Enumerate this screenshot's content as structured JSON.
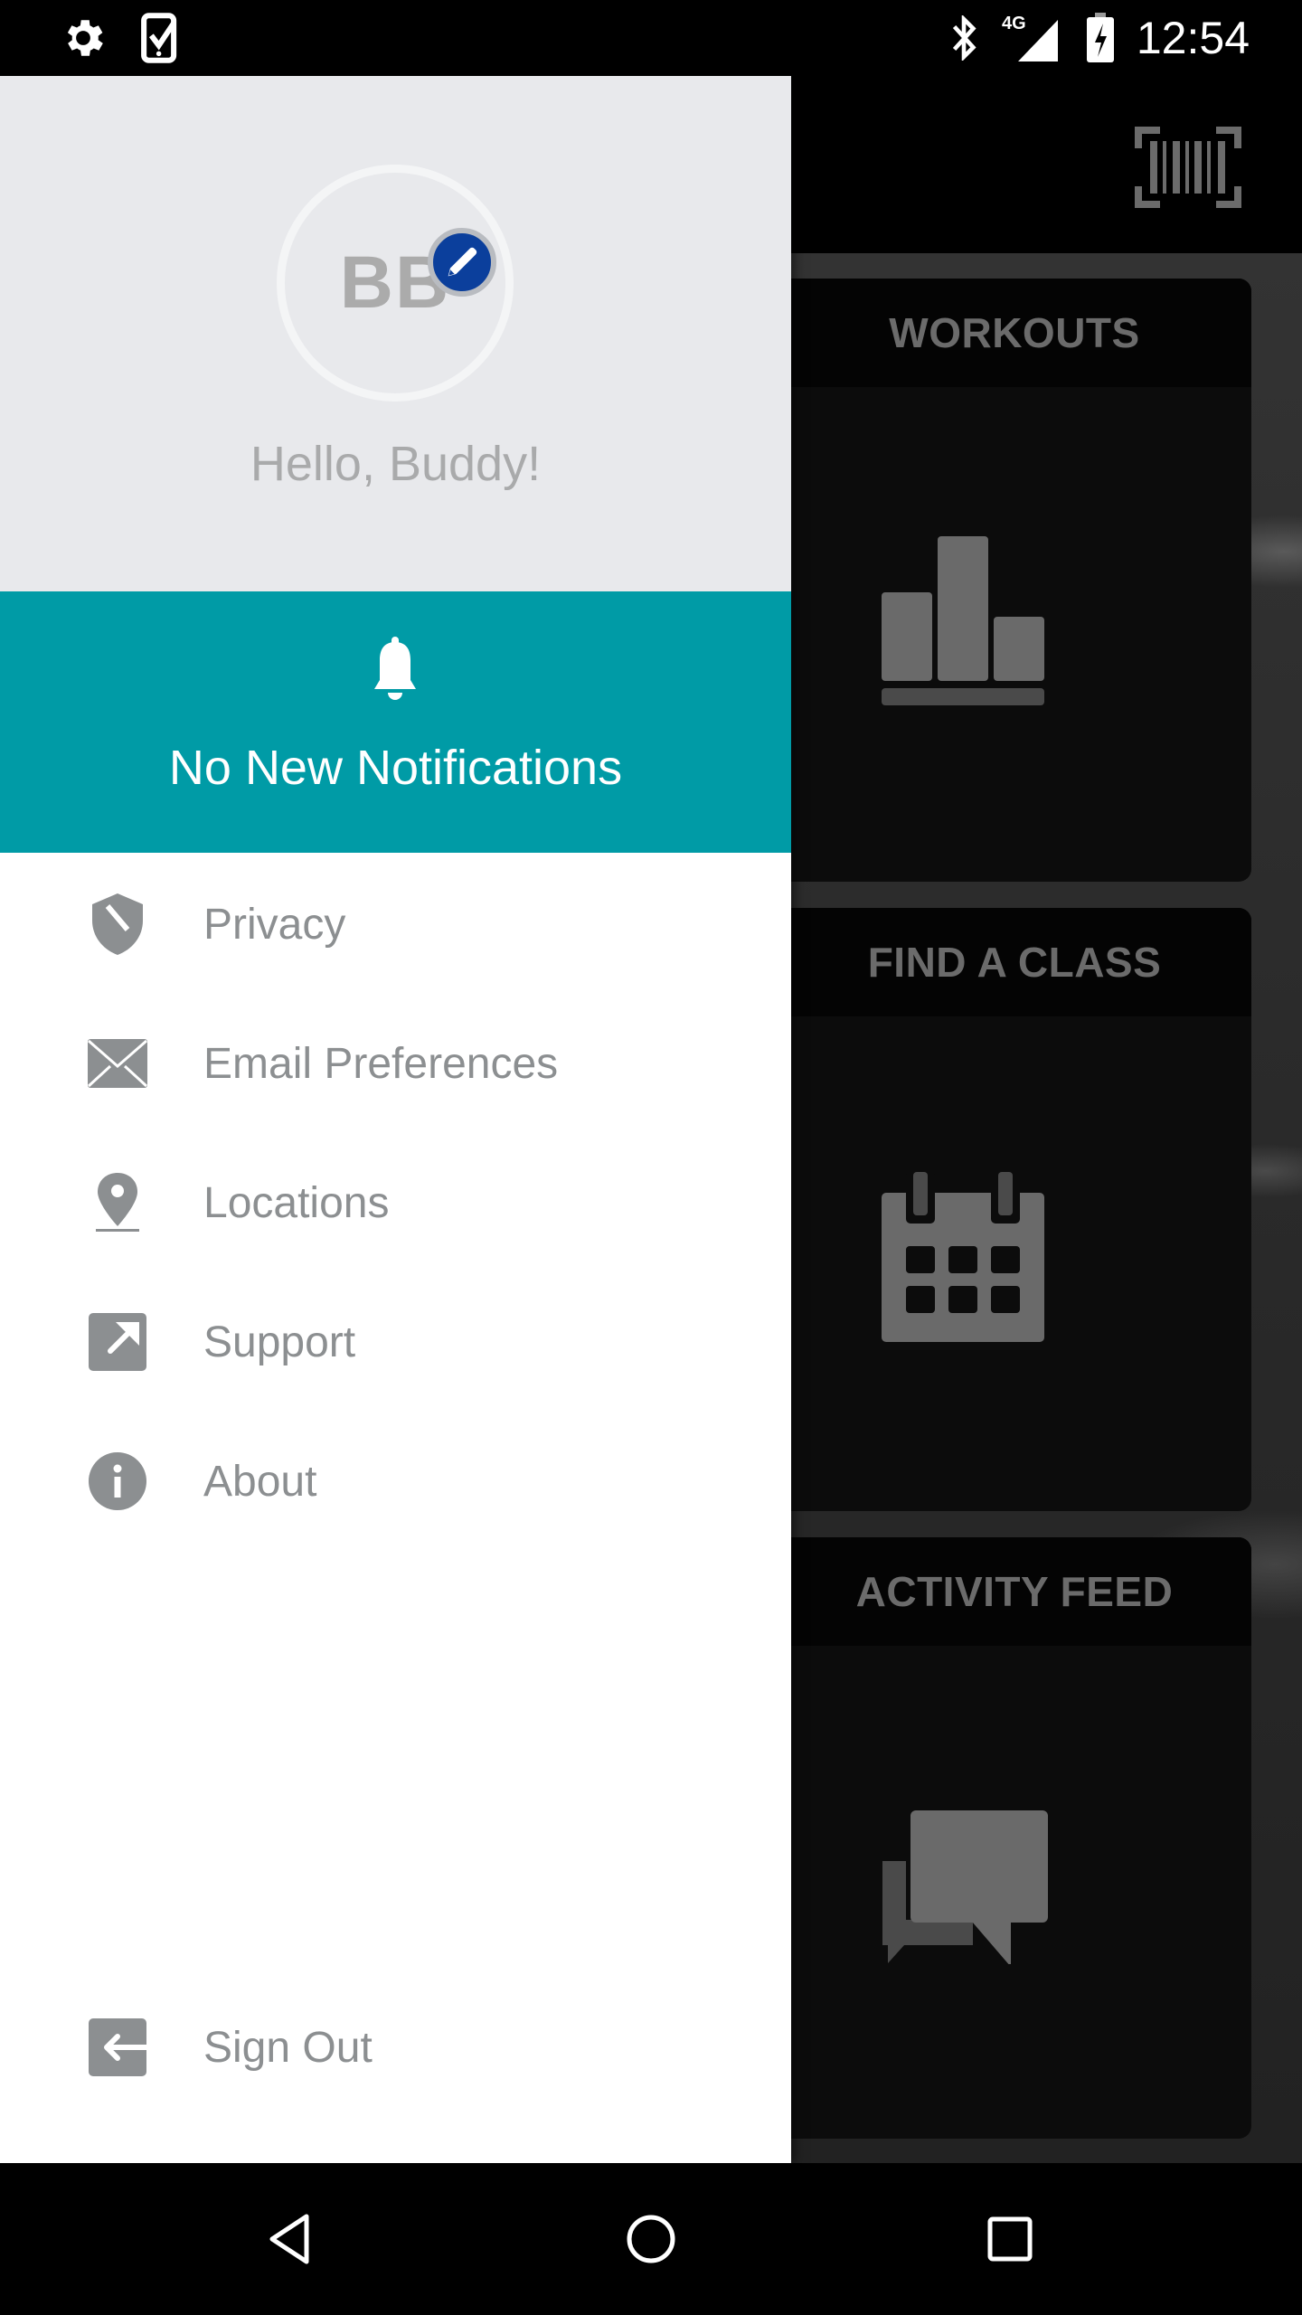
{
  "status_bar": {
    "left_icons": [
      "gear-icon",
      "phone-check-icon"
    ],
    "right_icons": [
      "bluetooth-icon",
      "signal-4g-icon",
      "battery-charging-icon"
    ],
    "network_label": "4G",
    "time": "12:54"
  },
  "background_app": {
    "header": {
      "action_icon": "barcode-scan-icon"
    },
    "cards": [
      {
        "title": "WORKOUTS",
        "icon": "bar-chart-icon"
      },
      {
        "title": "FIND A CLASS",
        "icon": "calendar-icon"
      },
      {
        "title": "ACTIVITY FEED",
        "icon": "chat-bubbles-icon"
      }
    ]
  },
  "drawer": {
    "profile": {
      "initials": "BB",
      "greeting": "Hello, Buddy!",
      "edit_icon": "pencil-icon"
    },
    "notifications": {
      "icon": "bell-icon",
      "text": "No New Notifications",
      "color": "#009ba6"
    },
    "menu": [
      {
        "label": "Privacy",
        "icon": "shield-icon"
      },
      {
        "label": "Email Preferences",
        "icon": "envelope-icon"
      },
      {
        "label": "Locations",
        "icon": "location-pin-icon"
      },
      {
        "label": "Support",
        "icon": "external-link-icon"
      },
      {
        "label": "About",
        "icon": "info-icon"
      }
    ],
    "sign_out": {
      "label": "Sign Out",
      "icon": "sign-out-icon"
    }
  },
  "nav_bar": {
    "buttons": [
      "back-icon",
      "home-icon",
      "recents-icon"
    ]
  },
  "colors": {
    "accent_teal": "#009ba6",
    "edit_badge_blue": "#0b3f9c",
    "menu_text": "#8c8f91",
    "drawer_header_bg": "#e8e9ec"
  }
}
